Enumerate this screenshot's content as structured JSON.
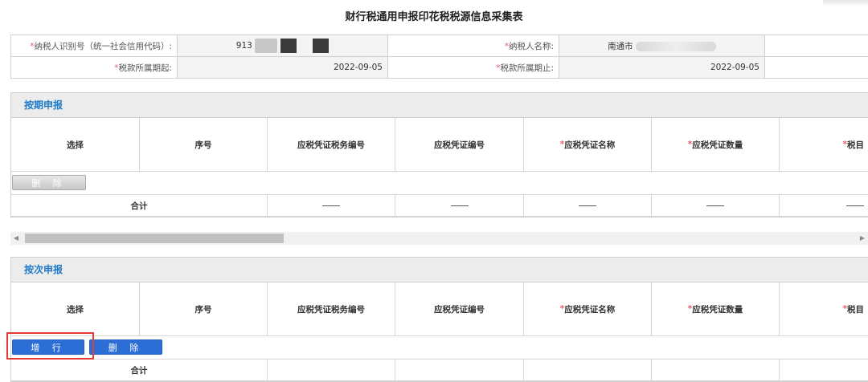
{
  "page": {
    "title": "财行税通用申报印花税税源信息采集表"
  },
  "info": {
    "row1": {
      "label1": "纳税人识别号（统一社会信用代码）:",
      "value1": "913",
      "label2": "纳税人名称:",
      "value2": "南通市"
    },
    "row2": {
      "label1": "税款所属期起:",
      "value1": "2022-09-05",
      "label2": "税款所属期止:",
      "value2": "2022-09-05"
    },
    "required_mark": "*"
  },
  "periodic": {
    "title": "按期申报",
    "columns": [
      {
        "label": "选择",
        "required": false
      },
      {
        "label": "序号",
        "required": false
      },
      {
        "label": "应税凭证税务编号",
        "required": false
      },
      {
        "label": "应税凭证编号",
        "required": false
      },
      {
        "label": "应税凭证名称",
        "required": true
      },
      {
        "label": "应税凭证数量",
        "required": true
      },
      {
        "label": "税目",
        "required": true
      }
    ],
    "delete_label": "删 除",
    "total_label": "合计"
  },
  "per_time": {
    "title": "按次申报",
    "columns": [
      {
        "label": "选择",
        "required": false
      },
      {
        "label": "序号",
        "required": false
      },
      {
        "label": "应税凭证税务编号",
        "required": false
      },
      {
        "label": "应税凭证编号",
        "required": false
      },
      {
        "label": "应税凭证名称",
        "required": true
      },
      {
        "label": "应税凭证数量",
        "required": true
      },
      {
        "label": "税目",
        "required": true
      }
    ],
    "add_label": "增 行",
    "delete_label": "删 除",
    "total_label": "合计"
  },
  "colors": {
    "accent": "#1e7ac8",
    "button_blue": "#2b6fd6",
    "highlight": "#e53935",
    "required": "#e0606a"
  }
}
